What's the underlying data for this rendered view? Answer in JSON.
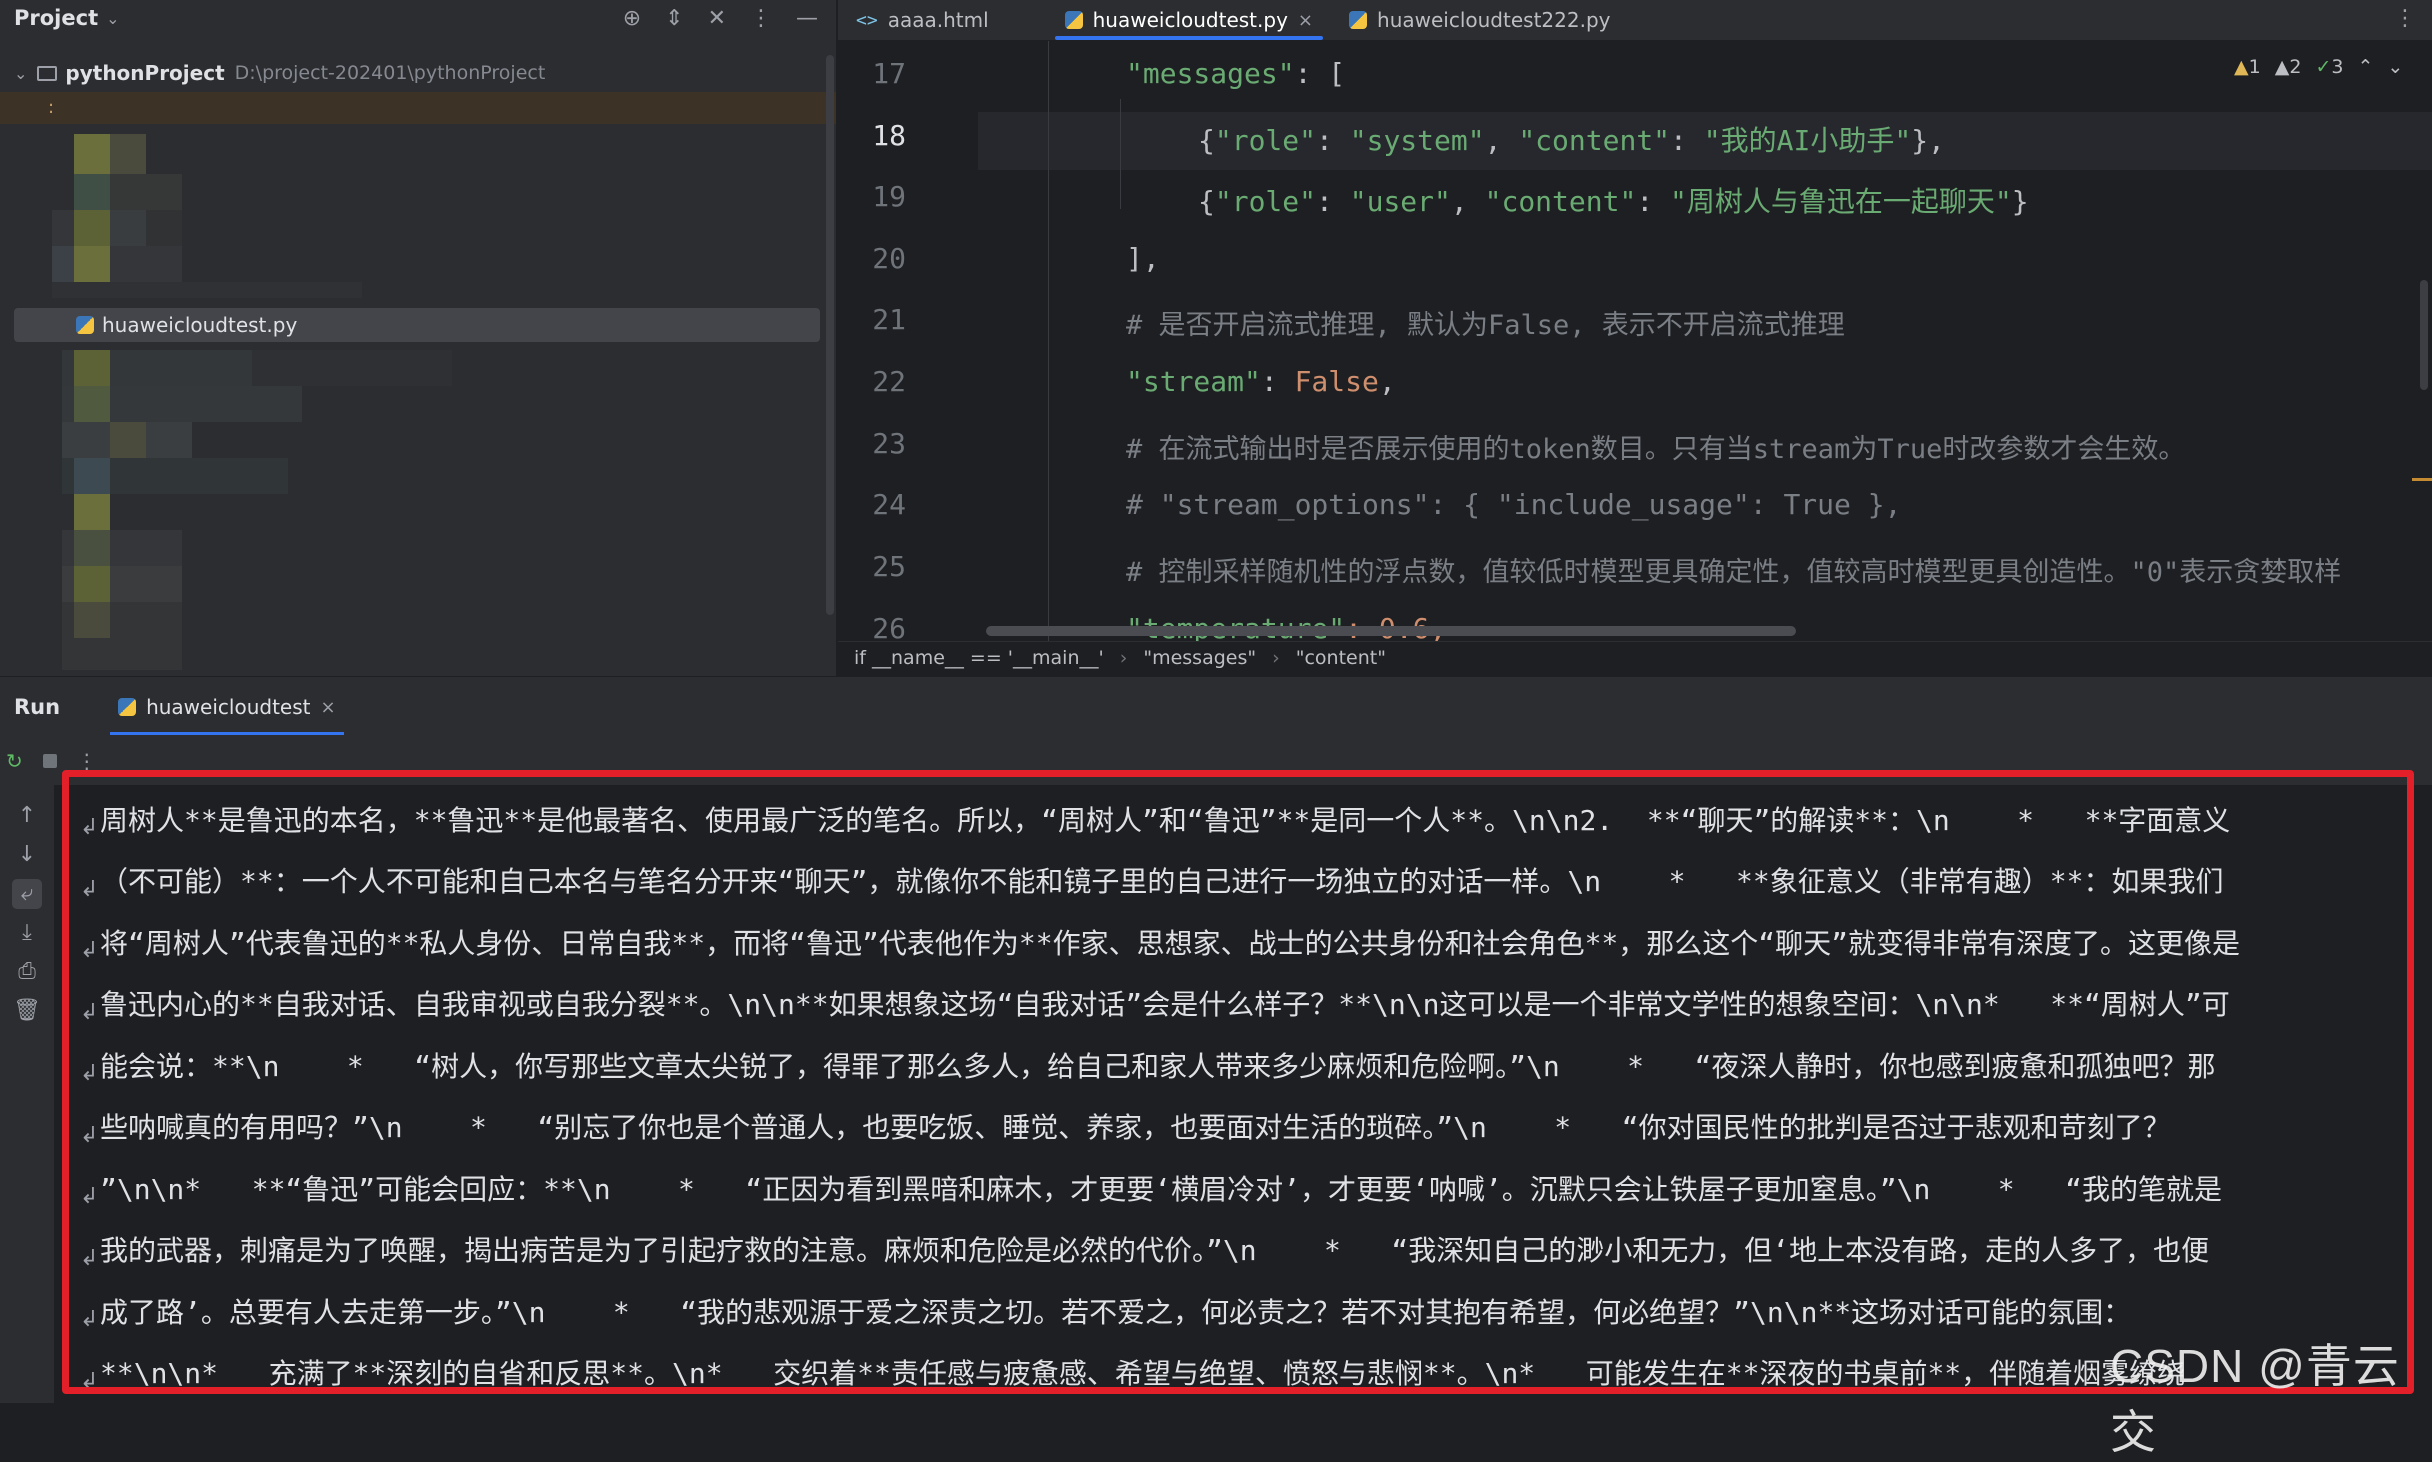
{
  "project": {
    "title": "Project",
    "root_name": "pythonProject",
    "root_path": "D:\\project-202401\\pythonProject",
    "selected_file": "huaweicloudtest.py",
    "highlight_row_text": ":"
  },
  "editor": {
    "tabs": [
      {
        "label": "aaaa.html",
        "icon": "html-icon",
        "active": false
      },
      {
        "label": "huaweicloudtest.py",
        "icon": "python-icon",
        "active": true,
        "close": "×"
      },
      {
        "label": "huaweicloudtest222.py",
        "icon": "python-icon",
        "active": false
      }
    ],
    "more": "⋮",
    "line_numbers": [
      "17",
      "18",
      "19",
      "20",
      "21",
      "22",
      "23",
      "24",
      "25",
      "26"
    ],
    "current_line": "18",
    "inspections": {
      "warnings_a": "1",
      "warnings_b": "2",
      "ok": "3"
    },
    "breadcrumbs": [
      "if __name__ == '__main__'",
      "\"messages\"",
      "\"content\""
    ]
  },
  "code": {
    "l17_key": "\"messages\"",
    "l17_rest": ": [",
    "l18_p1": "{",
    "l18_k1": "\"role\"",
    "l18_c1": ": ",
    "l18_v1": "\"system\"",
    "l18_c2": ", ",
    "l18_k2": "\"content\"",
    "l18_c3": ": ",
    "l18_v2": "\"我的AI小助手\"",
    "l18_end": "},",
    "l19_p1": "{",
    "l19_k1": "\"role\"",
    "l19_c1": ": ",
    "l19_v1": "\"user\"",
    "l19_c2": ", ",
    "l19_k2": "\"content\"",
    "l19_c3": ": ",
    "l19_v2": "\"周树人与鲁迅在一起聊天\"",
    "l19_end": "}",
    "l20": "],",
    "l21": "# 是否开启流式推理, 默认为False, 表示不开启流式推理",
    "l22_key": "\"stream\"",
    "l22_c": ": ",
    "l22_val": "False",
    "l22_end": ",",
    "l23": "# 在流式输出时是否展示使用的token数目。只有当stream为True时改参数才会生效。",
    "l24": "# \"stream_options\": { \"include_usage\": True },",
    "l25": "# 控制采样随机性的浮点数，值较低时模型更具确定性，值较高时模型更具创造性。\"0\"表示贪婪取样",
    "l26_key": "\"temperature\"",
    "l26_rest": ": 0.6,"
  },
  "run": {
    "label": "Run",
    "tab": "huaweicloudtest",
    "tab_close": "×",
    "toolbar_more": "⋮"
  },
  "output_lines": [
    "周树人**是鲁迅的本名，**鲁迅**是他最著名、使用最广泛的笔名。所以，“周树人”和“鲁迅”**是同一个人**。\\n\\n2.  **“聊天”的解读**：\\n    *   **字面意义",
    "（不可能）**：一个人不可能和自己本名与笔名分开来“聊天”，就像你不能和镜子里的自己进行一场独立的对话一样。\\n    *   **象征意义（非常有趣）**：如果我们",
    "将“周树人”代表鲁迅的**私人身份、日常自我**，而将“鲁迅”代表他作为**作家、思想家、战士的公共身份和社会角色**，那么这个“聊天”就变得非常有深度了。这更像是",
    "鲁迅内心的**自我对话、自我审视或自我分裂**。\\n\\n**如果想象这场“自我对话”会是什么样子？**\\n\\n这可以是一个非常文学性的想象空间：\\n\\n*   **“周树人”可",
    "能会说：**\\n    *   “树人，你写那些文章太尖锐了，得罪了那么多人，给自己和家人带来多少麻烦和危险啊。”\\n    *   “夜深人静时，你也感到疲惫和孤独吧？那",
    "些呐喊真的有用吗？”\\n    *   “别忘了你也是个普通人，也要吃饭、睡觉、养家，也要面对生活的琐碎。”\\n    *   “你对国民性的批判是否过于悲观和苛刻了？",
    "”\\n\\n*   **“鲁迅”可能会回应：**\\n    *   “正因为看到黑暗和麻木，才更要‘横眉冷对’，才更要‘呐喊’。沉默只会让铁屋子更加窒息。”\\n    *   “我的笔就是",
    "我的武器，刺痛是为了唤醒，揭出病苦是为了引起疗救的注意。麻烦和危险是必然的代价。”\\n    *   “我深知自己的渺小和无力，但‘地上本没有路，走的人多了，也便",
    "成了路’。总要有人去走第一步。”\\n    *   “我的悲观源于爱之深责之切。若不爱之，何必责之？若不对其抱有希望，何必绝望？”\\n\\n**这场对话可能的氛围：",
    "**\\n\\n*   充满了**深刻的自省和反思**。\\n*   交织着**责任感与疲惫感、希望与绝望、愤怒与悲悯**。\\n*   可能发生在**深夜的书桌前**，伴随着烟雾缭绕"
  ],
  "watermark": "CSDN @青云交"
}
